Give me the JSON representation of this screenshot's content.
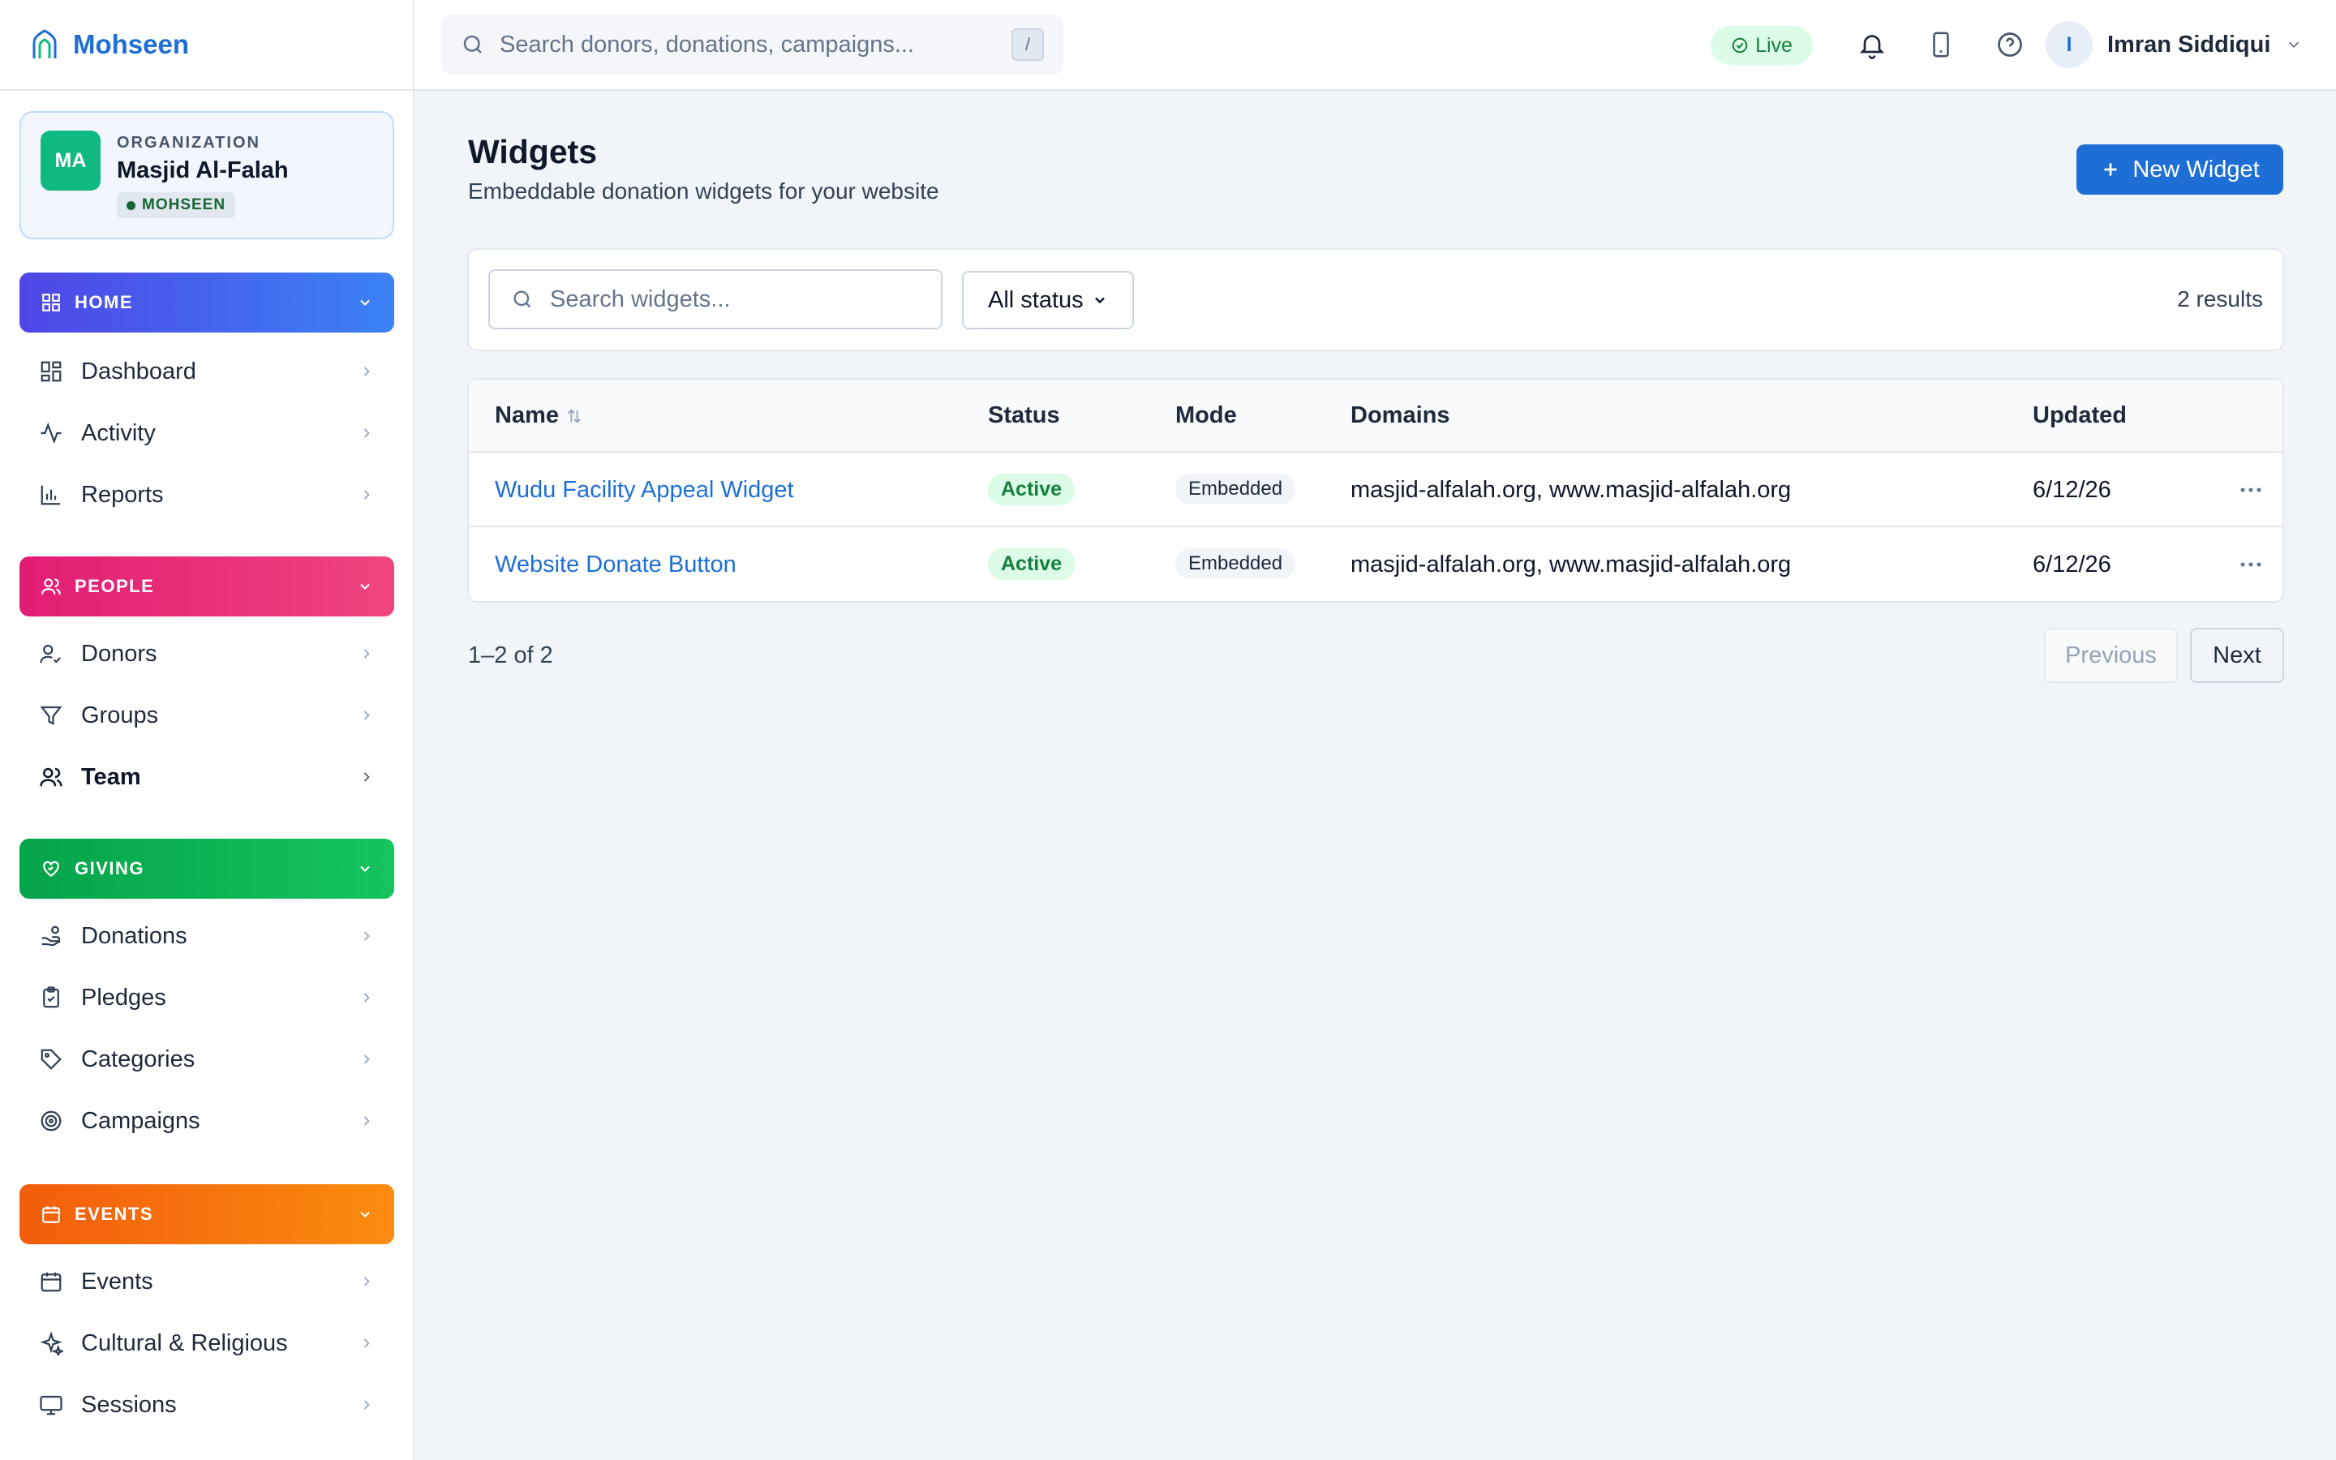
{
  "brand": {
    "name": "Mohseen"
  },
  "org": {
    "initials": "MA",
    "label": "ORGANIZATION",
    "name": "Masjid Al-Falah",
    "badge": "MOHSEEN"
  },
  "sidebar": {
    "sections": [
      {
        "label": "HOME",
        "items": [
          {
            "label": "Dashboard"
          },
          {
            "label": "Activity"
          },
          {
            "label": "Reports"
          }
        ]
      },
      {
        "label": "PEOPLE",
        "items": [
          {
            "label": "Donors"
          },
          {
            "label": "Groups"
          },
          {
            "label": "Team"
          }
        ]
      },
      {
        "label": "GIVING",
        "items": [
          {
            "label": "Donations"
          },
          {
            "label": "Pledges"
          },
          {
            "label": "Categories"
          },
          {
            "label": "Campaigns"
          }
        ]
      },
      {
        "label": "EVENTS",
        "items": [
          {
            "label": "Events"
          },
          {
            "label": "Cultural & Religious"
          },
          {
            "label": "Sessions"
          }
        ]
      }
    ]
  },
  "topbar": {
    "search_placeholder": "Search donors, donations, campaigns...",
    "shortcut": "/",
    "live": "Live",
    "user_initial": "I",
    "user_name": "Imran Siddiqui"
  },
  "page": {
    "title": "Widgets",
    "subtitle": "Embeddable donation widgets for your website",
    "new_button": "New Widget"
  },
  "filters": {
    "search_placeholder": "Search widgets...",
    "status": "All status",
    "results": "2 results"
  },
  "table": {
    "columns": [
      "Name",
      "Status",
      "Mode",
      "Domains",
      "Updated"
    ],
    "rows": [
      {
        "name": "Wudu Facility Appeal Widget",
        "status": "Active",
        "mode": "Embedded",
        "domains": "masjid-alfalah.org, www.masjid-alfalah.org",
        "updated": "6/12/26"
      },
      {
        "name": "Website Donate Button",
        "status": "Active",
        "mode": "Embedded",
        "domains": "masjid-alfalah.org, www.masjid-alfalah.org",
        "updated": "6/12/26"
      }
    ]
  },
  "pagination": {
    "summary": "1–2 of 2",
    "previous": "Previous",
    "next": "Next"
  },
  "colors": {
    "accent": "#1d6fd6",
    "home": "#4f46e5",
    "people": "#e11d74",
    "giving": "#05a34a",
    "events": "#f25d0c",
    "active": "#15803d"
  }
}
